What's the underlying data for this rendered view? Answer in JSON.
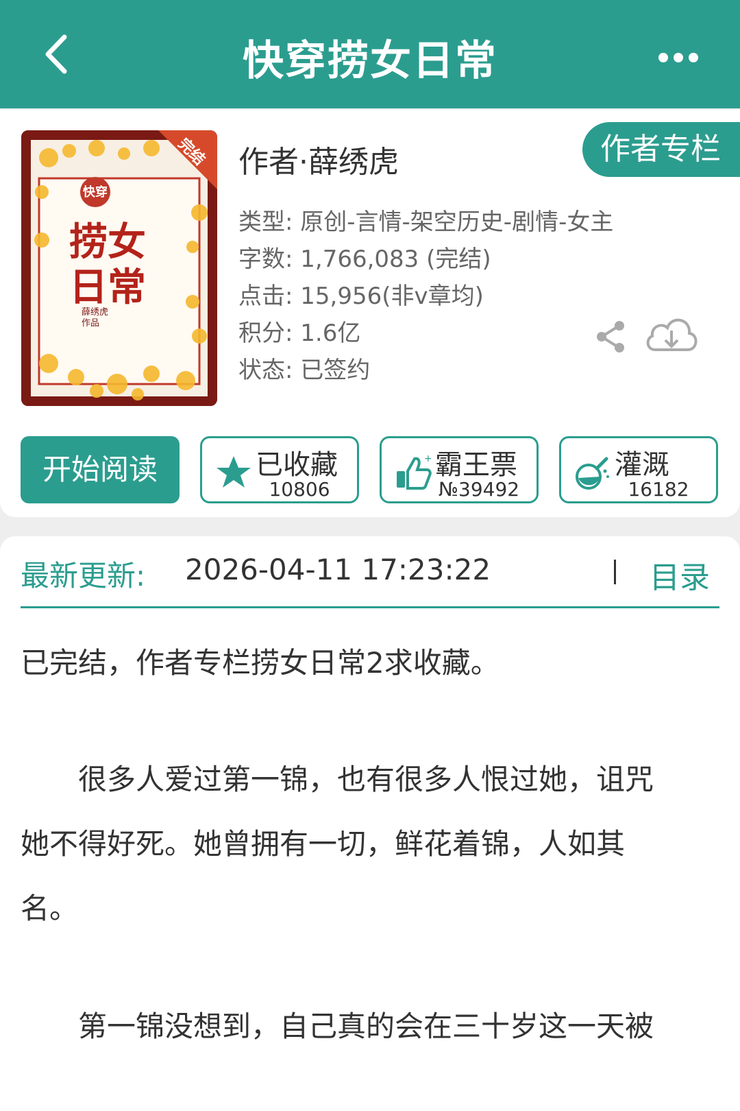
{
  "header": {
    "title": "快穿捞女日常",
    "back_icon": "chevron-left-icon",
    "more_icon": "more-horizontal-icon"
  },
  "book": {
    "cover": {
      "badge": "完结",
      "tag": "快穿",
      "title_art": "捞女日常",
      "author_small": "薛绣虎作品"
    },
    "author": "作者·薛绣虎",
    "author_column_button": "作者专栏",
    "meta": [
      "类型: 原创-言情-架空历史-剧情-女主",
      "字数: 1,766,083 (完结)",
      "点击: 15,956(非v章均)",
      "积分: 1.6亿",
      "状态: 已签约"
    ]
  },
  "actions": {
    "read_button": "开始阅读",
    "collect": {
      "label": "已收藏",
      "count": "10806",
      "icon": "star-icon"
    },
    "vote": {
      "label": "霸王票",
      "count": "№39492",
      "icon": "thumbs-up-icon"
    },
    "water": {
      "label": "灌溉",
      "count": "16182",
      "icon": "flask-icon"
    }
  },
  "update": {
    "label": "最新更新:",
    "time": "2026-04-11 17:23:22",
    "toc": "目录"
  },
  "summary": {
    "p1": "已完结，作者专栏捞女日常2求收藏。",
    "p2_line1": "　　很多人爱过第一锦，也有很多人恨过她，诅咒",
    "p2_line2": "她不得好死。她曾拥有一切，鲜花着锦，人如其",
    "p2_line3": "名。",
    "p3_line1": "　　第一锦没想到，自己真的会在三十岁这一天被"
  },
  "colors": {
    "accent": "#2b9d8f",
    "text": "#333333",
    "meta_text": "#666666",
    "cover_red": "#7a1a14"
  }
}
